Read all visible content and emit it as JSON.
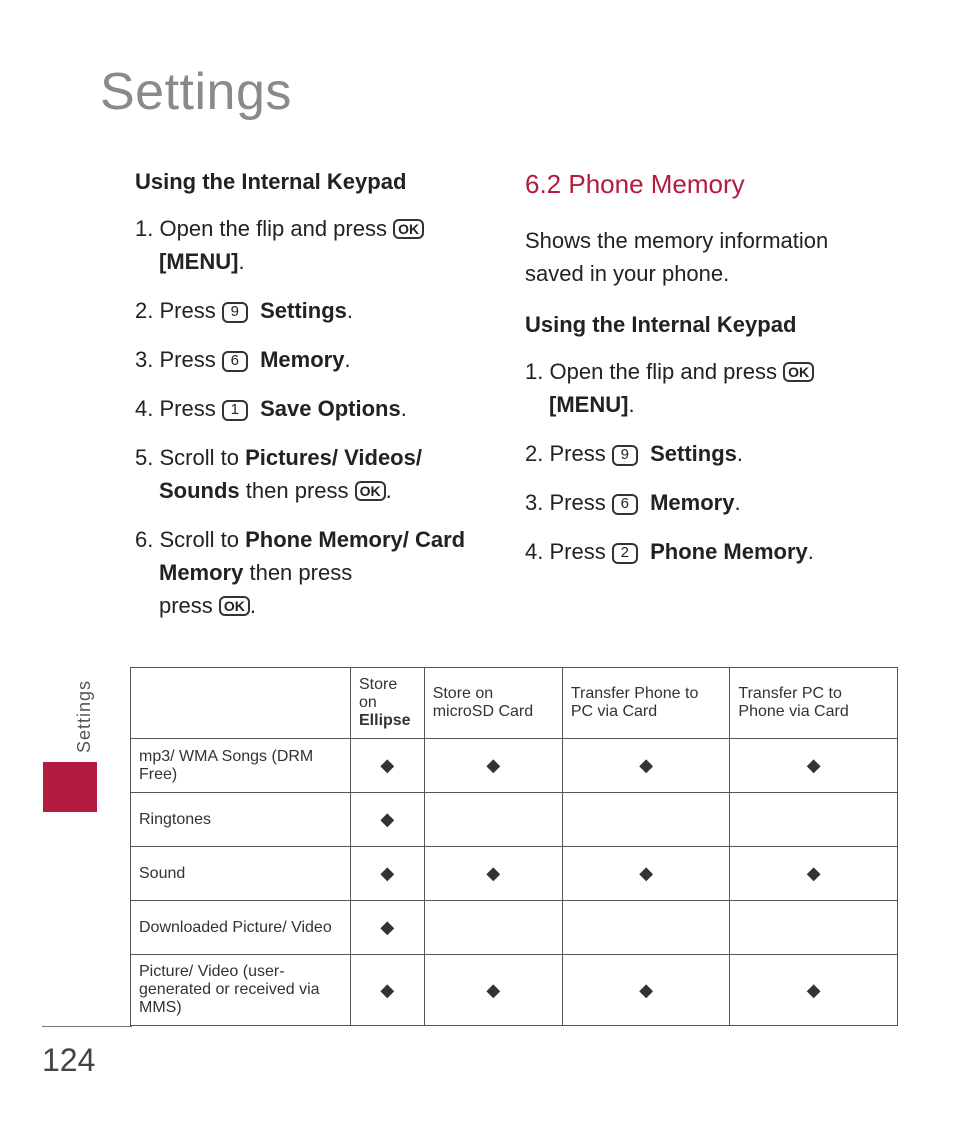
{
  "pageTitle": "Settings",
  "sideTab": "Settings",
  "pageNumber": "124",
  "left": {
    "heading": "Using the Internal Keypad",
    "steps": {
      "s1a": "Open the flip and press ",
      "s1b": "[MENU]",
      "s2a": "Press ",
      "s2key": "9",
      "s2b": "Settings",
      "s3a": "Press ",
      "s3key": "6",
      "s3b": "Memory",
      "s4a": "Press ",
      "s4key": "1",
      "s4b": "Save Options",
      "s5a": "Scroll to ",
      "s5b": "Pictures/ Videos/ Sounds",
      "s5c": " then press ",
      "s6a": "Scroll to ",
      "s6b": "Phone Memory/ Card Memory",
      "s6c": " then press "
    }
  },
  "right": {
    "sectionTitle": "6.2 Phone Memory",
    "intro": "Shows the memory information saved in your phone.",
    "heading": "Using the Internal Keypad",
    "steps": {
      "s1a": "Open the flip and press ",
      "s1b": "[MENU]",
      "s2a": "Press ",
      "s2key": "9",
      "s2b": "Settings",
      "s3a": "Press ",
      "s3key": "6",
      "s3b": "Memory",
      "s4a": "Press ",
      "s4key": "2",
      "s4b": "Phone Memory"
    }
  },
  "icons": {
    "ok": "OK"
  },
  "table": {
    "headers": {
      "c1a": "Store on",
      "c1b": "Ellipse",
      "c2": "Store on microSD Card",
      "c3": "Transfer Phone to PC via Card",
      "c4": "Transfer PC to Phone via Card"
    },
    "rows": [
      {
        "label": "mp3/ WMA Songs (DRM Free)",
        "c1": true,
        "c2": true,
        "c3": true,
        "c4": true
      },
      {
        "label": "Ringtones",
        "c1": true,
        "c2": false,
        "c3": false,
        "c4": false
      },
      {
        "label": "Sound",
        "c1": true,
        "c2": true,
        "c3": true,
        "c4": true
      },
      {
        "label": "Downloaded Picture/ Video",
        "c1": true,
        "c2": false,
        "c3": false,
        "c4": false
      },
      {
        "label": "Picture/ Video (user-generated or received via MMS)",
        "c1": true,
        "c2": true,
        "c3": true,
        "c4": true
      }
    ]
  },
  "marks": {
    "yes": "◆",
    "no": ""
  }
}
